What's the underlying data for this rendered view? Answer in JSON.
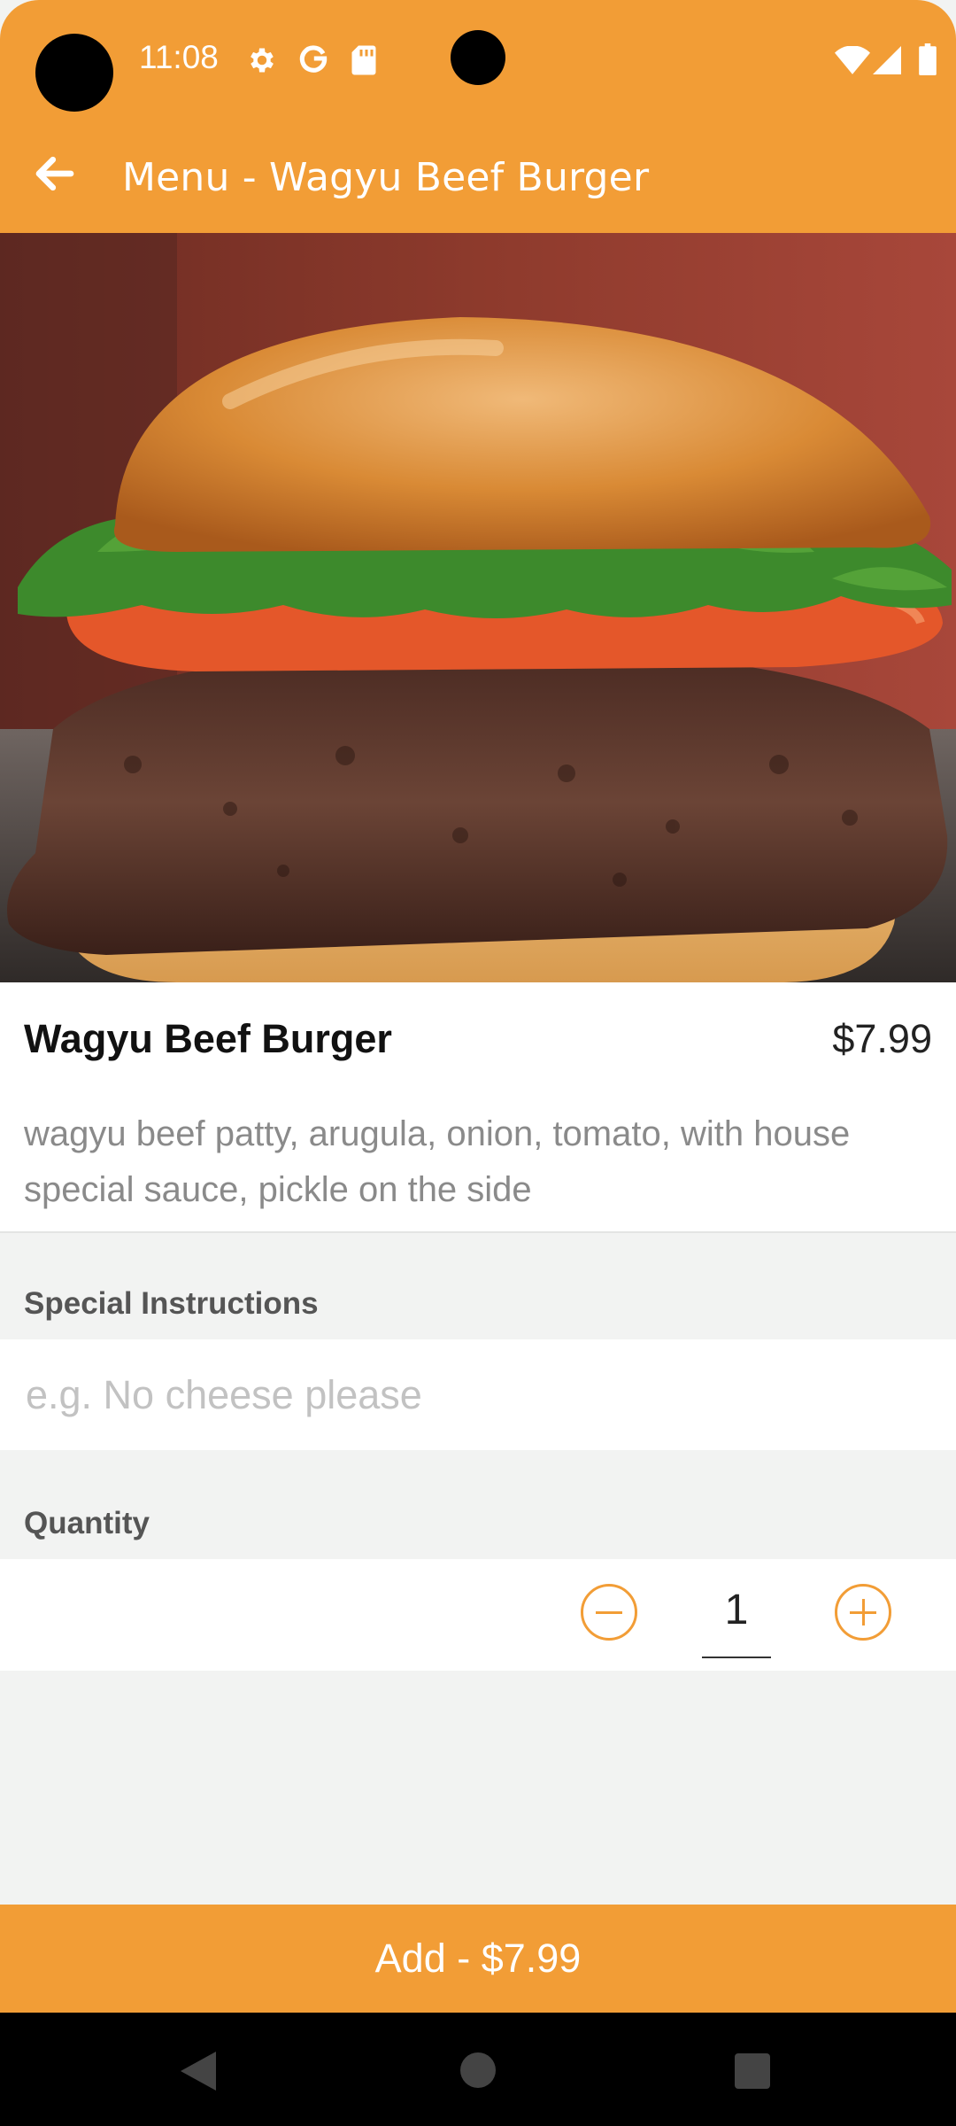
{
  "status_bar": {
    "time": "11:08",
    "left_icons": [
      "gear-icon",
      "google-icon",
      "sd-card-icon"
    ],
    "right_icons": [
      "wifi-icon",
      "signal-icon",
      "battery-icon"
    ]
  },
  "app_bar": {
    "title": "Menu - Wagyu Beef Burger",
    "back_icon": "arrow-left-icon"
  },
  "item": {
    "name": "Wagyu Beef Burger",
    "price": "$7.99",
    "description": "wagyu beef patty, arugula, onion, tomato, with house special sauce, pickle on the side"
  },
  "special_instructions": {
    "label": "Special Instructions",
    "placeholder": "e.g. No cheese please",
    "value": ""
  },
  "quantity": {
    "label": "Quantity",
    "value": "1",
    "decrement_icon": "minus-circle-icon",
    "increment_icon": "plus-circle-icon"
  },
  "add_button": {
    "label": "Add - $7.99"
  },
  "colors": {
    "accent": "#f29d36",
    "background": "#f2f3f2"
  }
}
